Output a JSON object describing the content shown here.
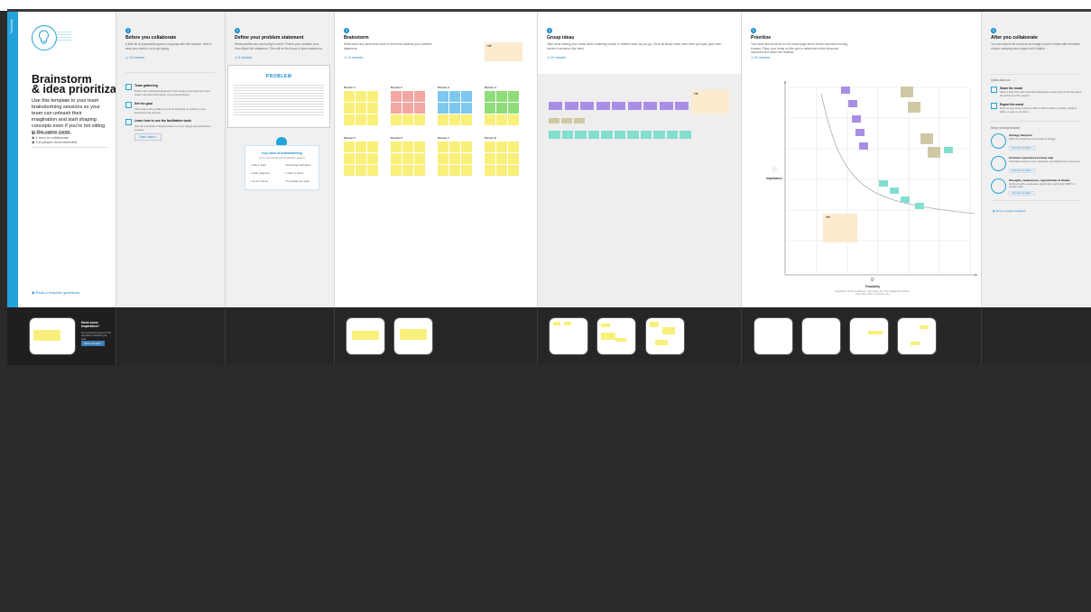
{
  "intro": {
    "side_label": "Template",
    "title_line1": "Brainstorm",
    "title_line2": "& idea prioritization",
    "description": "Use this template in your team brainstorming sessions so your team can unleash their imagination and start shaping concepts even if you're not sitting in the same room.",
    "stats": [
      "10 minutes to prepare",
      "1 hour to collaborate",
      "2-8 people recommended"
    ],
    "footer_link": "Read a template guidebook"
  },
  "before": {
    "step": "1",
    "heading": "Before you collaborate",
    "sub": "A little bit of preparation goes a long way with this session. Here's what you need to do to get going.",
    "time": "10 minutes",
    "items": [
      {
        "title": "Team gathering",
        "text": "Define who should participate in the session and send an invite. Share relevant information or pre-work ahead."
      },
      {
        "title": "Set the goal",
        "text": "Think about the problem you'll be focusing on solving in the brainstorming session."
      },
      {
        "title": "Learn how to use the facilitation tools",
        "text": "Use the Facilitation Superpowers to run a happy and productive session."
      }
    ],
    "button": "Open article"
  },
  "problem": {
    "step": "2",
    "heading": "Define your problem statement",
    "sub": "What problem are you trying to solve? Frame your problem as a How Might We statement. This will be the focus of your brainstorm.",
    "time": "5 minutes",
    "card_title": "PROBLEM",
    "rules_title": "Key rules of brainstorming",
    "rules_sub": "To run an smooth and productive session",
    "rules": [
      "Stay in topic.",
      "Encourage wild ideas.",
      "Defer judgment.",
      "Listen to others.",
      "Go for volume.",
      "If possible, be visual."
    ]
  },
  "brainstorm": {
    "step": "3",
    "heading": "Brainstorm",
    "sub": "Write down any ideas that come to mind that address your problem statement.",
    "time": "10 minutes",
    "tip_label": "TIP",
    "persons": [
      "Person 1",
      "Person 2",
      "Person 3",
      "Person 4",
      "Person 5",
      "Person 6",
      "Person 7",
      "Person 8"
    ]
  },
  "group": {
    "step": "4",
    "heading": "Group ideas",
    "sub": "Take turns sharing your ideas while clustering similar or related notes as you go. Once all sticky notes have been grouped, give each cluster a sentence-like label.",
    "time": "20 minutes",
    "tip_label": "TIP"
  },
  "prioritize": {
    "step": "5",
    "heading": "Prioritize",
    "sub": "Your team should all be on the same page about what's important moving forward. Place your ideas on this grid to determine which ideas are important and which are feasible.",
    "time": "20 minutes",
    "y_label": "Importance",
    "x_label": "Feasibility",
    "x_sub": "Regardless of their importance, which tasks are more feasible than others? (Cost, time, effort, complexity, etc.)",
    "tip_label": "TIP"
  },
  "after": {
    "step": "6",
    "heading": "After you collaborate",
    "sub": "You can export the mural as an image or pdf to share with members of your company who might find it helpful.",
    "quick_add_ons": "Quick add-ons",
    "items": [
      {
        "title": "Share the mural",
        "text": "Share a view link to the mural with stakeholders to keep them in the loop about the outcomes of the session."
      },
      {
        "title": "Export the mural",
        "text": "Export a copy of the mural as a PNG or PDF to attach to emails, include in slides, or save in your drive."
      }
    ],
    "keep_moving": "Keep moving forward",
    "templates": [
      {
        "title": "Strategy blueprint",
        "text": "Define the components of a new idea or strategy.",
        "link": "Open the template"
      },
      {
        "title": "Customer experience journey map",
        "text": "Understand customer needs, motivations, and obstacles for an experience.",
        "link": "Open the template"
      },
      {
        "title": "Strengths, weaknesses, opportunities & threats",
        "text": "Identify strengths, weaknesses, opportunities, and threats (SWOT) to develop a plan.",
        "link": "Open the template"
      }
    ],
    "feedback": "Share template feedback"
  },
  "strip": {
    "need_ideas": "Need some inspiration?",
    "need_ideas_sub": "See a finished version of this template to kickstart your work.",
    "open_example": "Open example"
  },
  "colors": {
    "accent": "#21a3d9",
    "yellow": "#f8f07a",
    "purple": "#a98ee6",
    "teal": "#82dfcf"
  }
}
